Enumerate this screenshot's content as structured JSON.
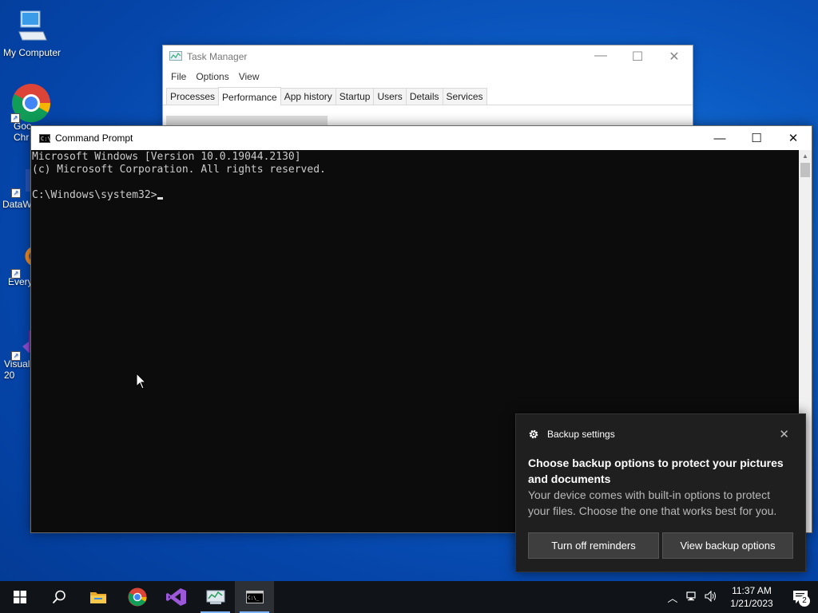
{
  "desktop": {
    "icons": [
      {
        "label": "My Computer"
      },
      {
        "label": "Goo\nChr"
      },
      {
        "label": "DataW"
      },
      {
        "label": "Every"
      },
      {
        "label": "Visual\n20"
      }
    ]
  },
  "task_manager": {
    "title": "Task Manager",
    "menu": [
      "File",
      "Options",
      "View"
    ],
    "tabs": [
      "Processes",
      "Performance",
      "App history",
      "Startup",
      "Users",
      "Details",
      "Services"
    ],
    "active_tab": "Performance"
  },
  "cmd": {
    "title": "Command Prompt",
    "lines": [
      "Microsoft Windows [Version 10.0.19044.2130]",
      "(c) Microsoft Corporation. All rights reserved.",
      "",
      "C:\\Windows\\system32>"
    ]
  },
  "toast": {
    "app": "Backup settings",
    "title": "Choose backup options to protect your pictures and documents",
    "text": "Your device comes with built-in options to protect your files. Choose the one that works best for you.",
    "button1": "Turn off reminders",
    "button2": "View backup options"
  },
  "taskbar": {
    "time": "11:37 AM",
    "date": "1/21/2023",
    "notification_count": "2"
  },
  "colors": {
    "taskbar_bg": "#101418",
    "console_bg": "#0c0c0c",
    "console_text": "#cccccc",
    "toast_bg": "#1f1f1f"
  }
}
